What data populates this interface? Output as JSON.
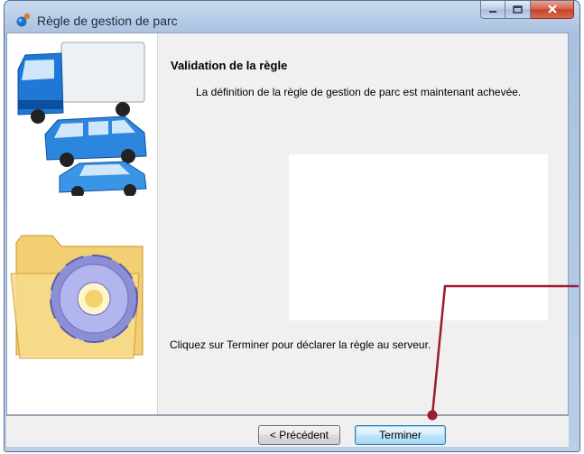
{
  "window": {
    "title": "Règle de gestion de parc",
    "icons": [
      "app-icon",
      "minimize-icon",
      "maximize-icon",
      "close-icon"
    ]
  },
  "side_panel": {
    "images": [
      "vehicles-illustration",
      "folder-gear-illustration"
    ]
  },
  "main": {
    "heading": "Validation de la règle",
    "description": "La définition de la règle de gestion de parc est maintenant achevée.",
    "instruction": "Cliquez sur Terminer pour déclarer la règle au serveur."
  },
  "buttons": {
    "previous_label": "< Précédent",
    "finish_label": "Terminer"
  },
  "colors": {
    "callout": "#9b1b30",
    "title_bar": "#b5cbe6",
    "close_button": "#c2412a"
  }
}
